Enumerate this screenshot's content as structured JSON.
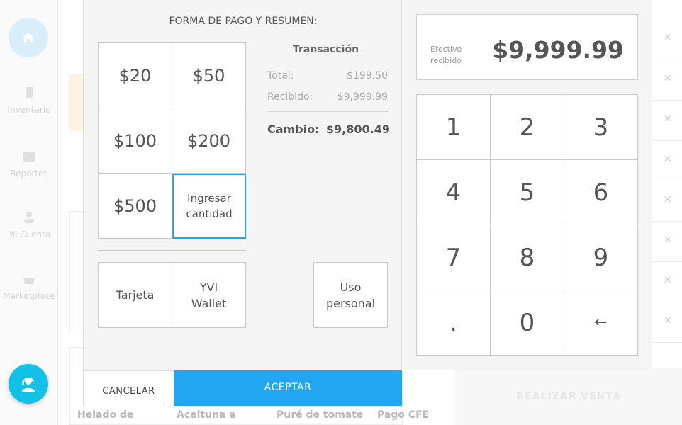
{
  "background": {
    "sidebar": [
      {
        "label": "Inventario"
      },
      {
        "label": "Reportes"
      },
      {
        "label": "Mi Cuenta"
      },
      {
        "label": "Marketplace"
      }
    ],
    "products": [
      "Helado de",
      "Aceituna a",
      "Puré de tomate",
      "Pago CFE"
    ],
    "realizar_label": "REALIZAR VENTA"
  },
  "modal": {
    "title": "FORMA DE PAGO Y RESUMEN:",
    "bills": [
      "$20",
      "$50",
      "$100",
      "$200",
      "$500",
      "Ingresar cantidad"
    ],
    "payment_methods": [
      "Tarjeta",
      "YVI Wallet",
      "Uso personal"
    ],
    "transaction": {
      "title": "Transacción",
      "total_label": "Total:",
      "total_value": "$199.50",
      "received_label": "Recibido:",
      "received_value": "$9,999.99",
      "change_label": "Cambio:",
      "change_value": "$9,800.49"
    },
    "cancel_label": "CANCELAR",
    "accept_label": "ACEPTAR",
    "cash": {
      "label": "Efectivo recibido",
      "value": "$9,999.99"
    },
    "keypad": [
      "1",
      "2",
      "3",
      "4",
      "5",
      "6",
      "7",
      "8",
      "9",
      ".",
      "0",
      "←"
    ]
  },
  "colors": {
    "accent": "#23a6f2",
    "support": "#12c0e8"
  }
}
